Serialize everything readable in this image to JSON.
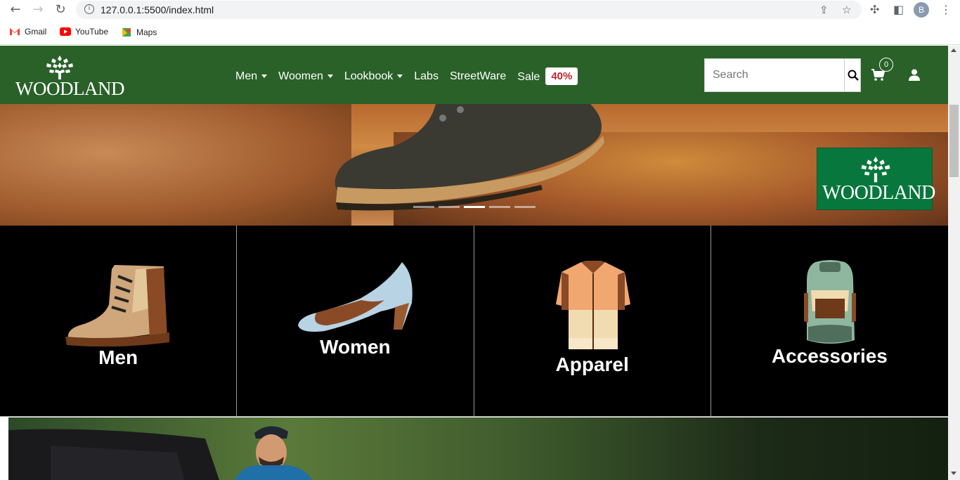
{
  "browser": {
    "url": "127.0.0.1:5500/index.html",
    "profile_initial": "B",
    "bookmarks": [
      {
        "label": "Gmail",
        "icon": "gmail-icon",
        "color": "#ea4335"
      },
      {
        "label": "YouTube",
        "icon": "youtube-icon",
        "color": "#ff0000"
      },
      {
        "label": "Maps",
        "icon": "maps-icon",
        "color": "#34a853"
      }
    ]
  },
  "header": {
    "brand": "WOODLAND",
    "nav": [
      {
        "label": "Men",
        "dropdown": true
      },
      {
        "label": "Woomen",
        "dropdown": true
      },
      {
        "label": "Lookbook",
        "dropdown": true
      },
      {
        "label": "Labs",
        "dropdown": false
      },
      {
        "label": "StreetWare",
        "dropdown": false
      },
      {
        "label": "Sale",
        "dropdown": false
      }
    ],
    "sale_badge": "40%",
    "search_placeholder": "Search",
    "cart_count": "0",
    "accent_color": "#296128"
  },
  "hero": {
    "brand": "WOODLAND",
    "slides": 5,
    "active_slide": 3
  },
  "categories": [
    {
      "label": "Men",
      "icon": "boot-icon"
    },
    {
      "label": "Women",
      "icon": "heel-icon"
    },
    {
      "label": "Apparel",
      "icon": "shirt-icon"
    },
    {
      "label": "Accessories",
      "icon": "backpack-icon"
    }
  ]
}
